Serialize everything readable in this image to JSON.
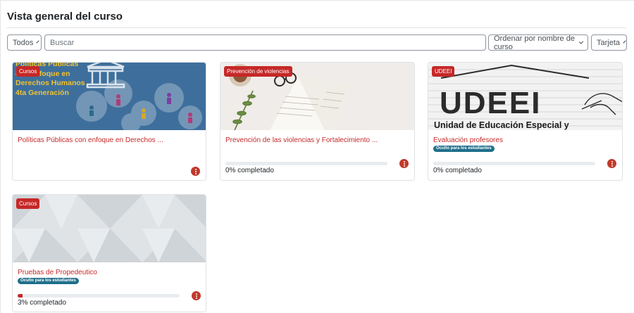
{
  "page": {
    "title": "Vista general del curso"
  },
  "toolbar": {
    "filter_label": "Todos",
    "search_placeholder": "Buscar",
    "sort_label": "Ordenar por nombre de curso",
    "view_label": "Tarjeta"
  },
  "image_text": {
    "course1": [
      "Políticas Públicas",
      "con enfoque en",
      "Derechos Humanos",
      "4ta Generación"
    ],
    "course3": [
      "UDEEI",
      "Unidad de Educación Especial y"
    ]
  },
  "courses": [
    {
      "category": "Cursos",
      "name": "Políticas Públicas con enfoque en Derechos ...",
      "hidden_label": "",
      "progress_text": "",
      "progress": null
    },
    {
      "category": "Prevención de violencias",
      "name": "Prevención de las violencias y Fortalecimiento ...",
      "hidden_label": "",
      "progress_text": "0% completado",
      "progress": 0
    },
    {
      "category": "UDEEI",
      "name": "Evaluación profesores",
      "hidden_label": "Oculto para los estudiantes",
      "progress_text": "0% completado",
      "progress": 0
    },
    {
      "category": "Cursos",
      "name": "Pruebas de Propedeutico",
      "hidden_label": "Oculto para los estudiantes",
      "progress_text": "3% completado",
      "progress": 3
    }
  ],
  "colors": {
    "accent": "#c62828",
    "hidden_badge": "#1f6f8b",
    "progress_track": "#e9ecef"
  },
  "icons": {
    "menu": "kebab-menu-icon",
    "dropdown": "chevron-down-icon"
  }
}
